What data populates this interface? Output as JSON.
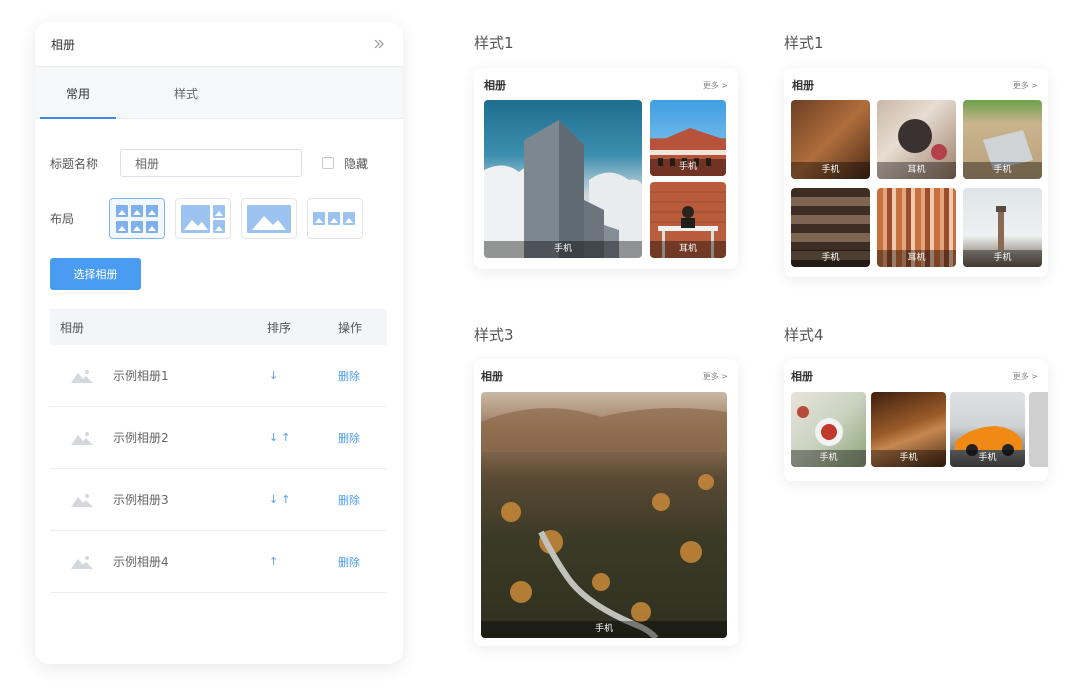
{
  "panel": {
    "title": "相册",
    "tabs": [
      {
        "label": "常用"
      },
      {
        "label": "样式"
      }
    ],
    "form": {
      "title_label": "标题名称",
      "title_value": "相册",
      "hide_label": "隐藏",
      "layout_label": "布局"
    },
    "choose_button": "选择相册",
    "table": {
      "headers": {
        "album": "相册",
        "sort": "排序",
        "action": "操作"
      },
      "rows": [
        {
          "name": "示例相册1",
          "sort": "↓",
          "action": "删除"
        },
        {
          "name": "示例相册2",
          "sort": "↓↑",
          "action": "删除"
        },
        {
          "name": "示例相册3",
          "sort": "↓↑",
          "action": "删除"
        },
        {
          "name": "示例相册4",
          "sort": "↑",
          "action": "删除"
        }
      ]
    }
  },
  "previews": [
    {
      "style_label": "样式1",
      "title": "相册",
      "more": "更多 >",
      "captions": [
        "手机",
        "手机",
        "耳机"
      ]
    },
    {
      "style_label": "样式1",
      "title": "相册",
      "more": "更多 >",
      "captions": [
        "手机",
        "耳机",
        "手机",
        "手机",
        "耳机",
        "手机"
      ]
    },
    {
      "style_label": "样式3",
      "title": "相册",
      "more": "更多 >",
      "captions": [
        "手机"
      ]
    },
    {
      "style_label": "样式4",
      "title": "相册",
      "more": "更多 >",
      "captions": [
        "手机",
        "手机",
        "手机"
      ]
    }
  ],
  "colors": {
    "accent": "#4a9cf2",
    "tab_indicator": "#3b8cf0"
  }
}
